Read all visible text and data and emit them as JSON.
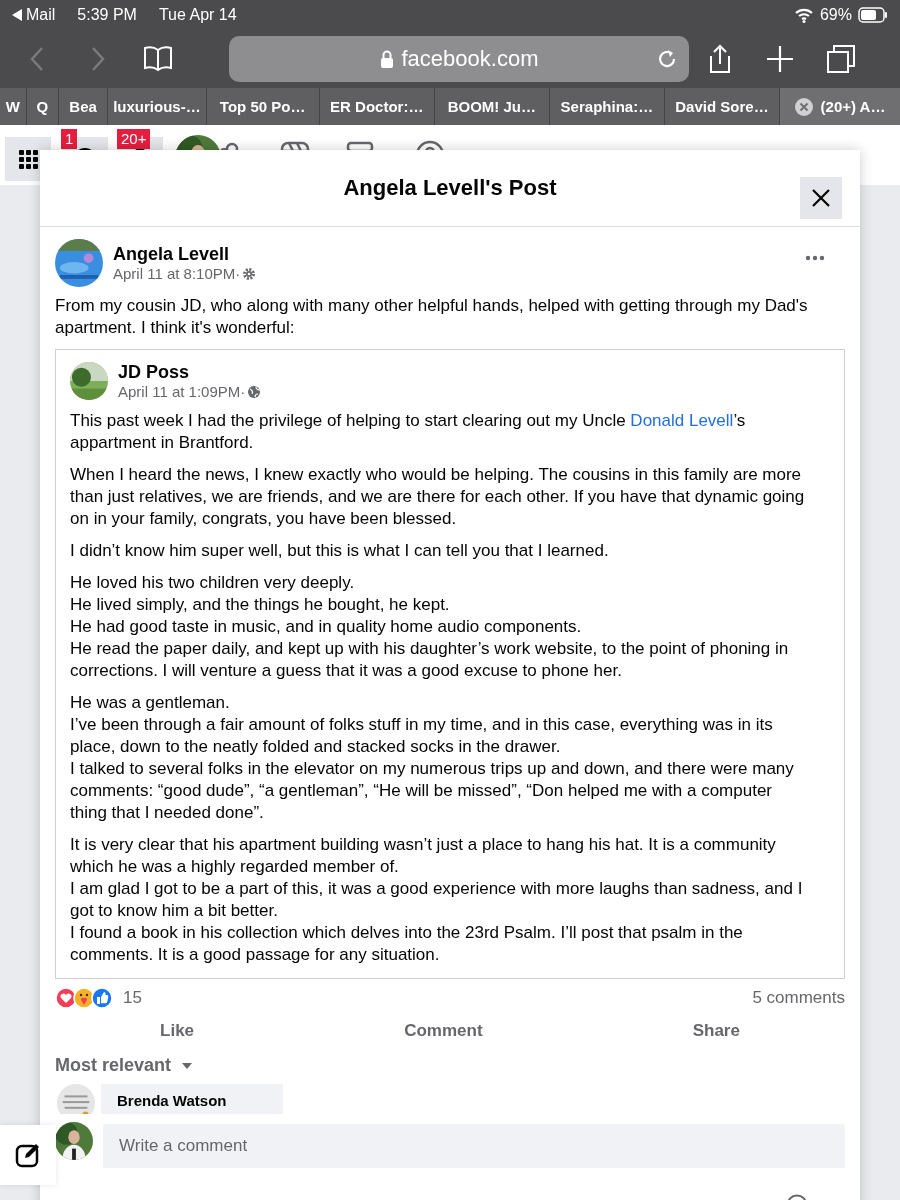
{
  "status_bar": {
    "back_app": "Mail",
    "time": "5:39 PM",
    "date": "Tue Apr 14",
    "battery": "69%"
  },
  "address_bar": {
    "url": "facebook.com"
  },
  "tabs": [
    {
      "label": "W",
      "selected": false
    },
    {
      "label": "Q",
      "selected": false
    },
    {
      "label": "Bea",
      "selected": false
    },
    {
      "label": "luxurious-…",
      "selected": false
    },
    {
      "label": "Top 50 Po…",
      "selected": false
    },
    {
      "label": "ER Doctor:…",
      "selected": false
    },
    {
      "label": "BOOM! Ju…",
      "selected": false
    },
    {
      "label": "Seraphina:…",
      "selected": false
    },
    {
      "label": "David Sore…",
      "selected": false
    },
    {
      "label": "(20+) A…",
      "selected": true
    }
  ],
  "nav": {
    "messenger_badge": "1",
    "notifications_badge": "20+"
  },
  "dialog": {
    "title": "Angela Levell's Post",
    "post": {
      "author": "Angela Levell",
      "time": "April 11 at 8:10PM·",
      "text": "From my cousin JD, who along with many other helpful hands, helped with getting through my Dad's apartment. I think it's wonderful:",
      "shared": {
        "author": "JD Poss",
        "time": "April 11 at 1:09PM·",
        "paragraphs": [
          [
            [
              {
                "text": "This past week I had the privilege of helping to start clearing out my Uncle "
              },
              {
                "link": "Donald Levell"
              },
              {
                "text": "’s appartment in Brantford."
              }
            ]
          ],
          [
            "When I heard the news, I knew exactly who would be helping. The cousins in this family are more than just relatives, we are friends, and we are there for each other. If you have that dynamic going on in your family, congrats, you have been blessed."
          ],
          [
            "I didn’t know him super well, but this is what I can tell you that I learned."
          ],
          [
            "He loved his two children very deeply.",
            "He lived simply, and the things he bought, he kept.",
            "He had good taste in music, and in quality home audio components.",
            "He read the paper daily, and kept up with his daughter’s work website, to the point of phoning in corrections. I will venture a guess that it was a good excuse to phone her."
          ],
          [
            "He was a gentleman.",
            "I’ve been through a fair amount of folks stuff in my time, and in this case, everything was in its place, down to the neatly folded and stacked socks in the drawer.",
            "I talked to several folks in the elevator on my numerous trips up and down, and there were many comments: “good dude”, “a gentleman”, “He will be missed”, “Don helped me with a computer thing that I needed done”."
          ],
          [
            "It is very clear that his apartment building wasn’t just a place to hang his hat. It is a community which he was a highly regarded member of.",
            "I am glad I got to be a part of this, it was a good experience with more laughs than sadness, and I got to know him a bit better.",
            "I found a book in his collection which delves into the 23rd Psalm. I’ll post that psalm in the comments. It is a good passage for any situation."
          ]
        ]
      },
      "reaction_count": "15",
      "comment_count": "5 comments",
      "actions": [
        "Like",
        "Comment",
        "Share"
      ]
    },
    "sort": "Most relevant",
    "comments": [
      {
        "author": "Brenda Watson"
      }
    ],
    "comment_field": {
      "placeholder": "Write a comment"
    }
  }
}
